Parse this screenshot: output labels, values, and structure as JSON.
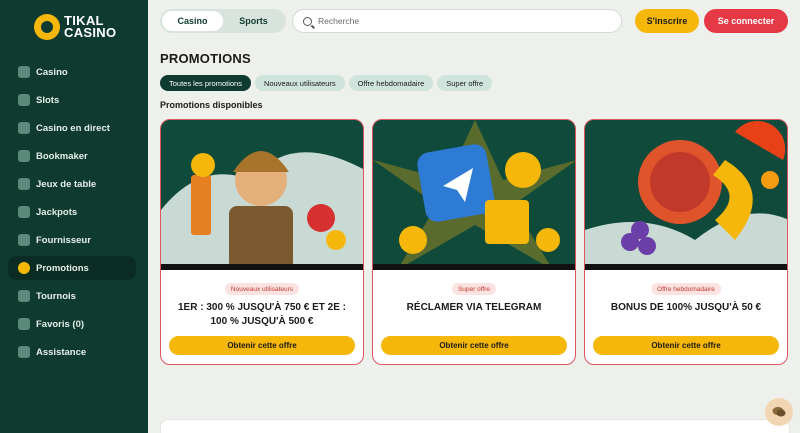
{
  "brand": {
    "line1": "TIKAL",
    "line2": "CASINO"
  },
  "sidebar": {
    "items": [
      {
        "label": "Casino"
      },
      {
        "label": "Slots"
      },
      {
        "label": "Casino en direct"
      },
      {
        "label": "Bookmaker"
      },
      {
        "label": "Jeux de table"
      },
      {
        "label": "Jackpots"
      },
      {
        "label": "Fournisseur"
      },
      {
        "label": "Promotions"
      },
      {
        "label": "Tournois"
      },
      {
        "label": "Favoris (0)"
      },
      {
        "label": "Assistance"
      }
    ]
  },
  "header": {
    "tabs": [
      {
        "label": "Casino"
      },
      {
        "label": "Sports"
      }
    ],
    "search_placeholder": "Recherche",
    "signup_label": "S'inscrire",
    "login_label": "Se connecter"
  },
  "page": {
    "title": "PROMOTIONS",
    "subtitle": "Promotions disponibles"
  },
  "filters": [
    {
      "label": "Toutes les promotions"
    },
    {
      "label": "Nouveaux utilisateurs"
    },
    {
      "label": "Offre hebdomadaire"
    },
    {
      "label": "Super offre"
    }
  ],
  "cards": [
    {
      "badge": "Nouveaux utilisateurs",
      "title": "1ER : 300 % JUSQU'À 750 € ET 2E : 100 % JUSQU'À 500 €",
      "button": "Obtenir cette offre"
    },
    {
      "badge": "Super offre",
      "title": "RÉCLAMER VIA TELEGRAM",
      "button": "Obtenir cette offre"
    },
    {
      "badge": "Offre hebdomadaire",
      "title": "BONUS DE 100% JUSQU'À 50 €",
      "button": "Obtenir cette offre"
    }
  ],
  "colors": {
    "sidebar": "#0f3a2f",
    "accent": "#f5b80a",
    "login": "#e63946",
    "card_border": "#e0545e"
  },
  "icons": {
    "logo": "tikal-logo-icon",
    "search": "search-icon",
    "chat": "chat-icon"
  }
}
